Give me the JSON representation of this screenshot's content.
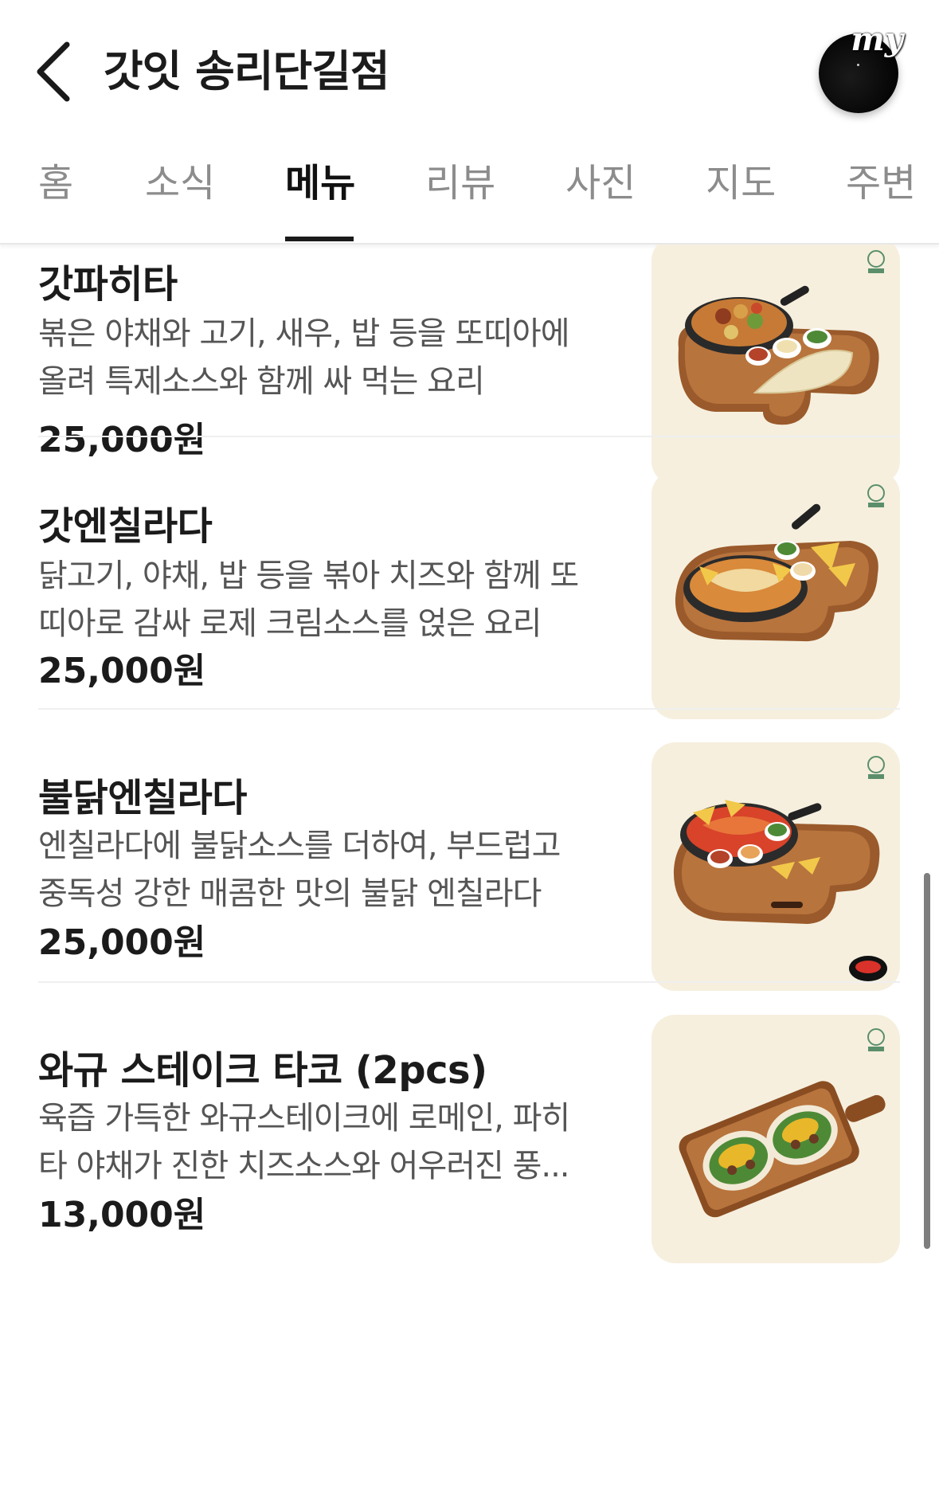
{
  "header": {
    "title": "갓잇 송리단길점",
    "my_label": "my",
    "back_icon": "chevron-left-icon"
  },
  "tabs": [
    {
      "label": "홈",
      "active": false
    },
    {
      "label": "소식",
      "active": false
    },
    {
      "label": "메뉴",
      "active": true
    },
    {
      "label": "리뷰",
      "active": false
    },
    {
      "label": "사진",
      "active": false
    },
    {
      "label": "지도",
      "active": false
    },
    {
      "label": "주변",
      "active": false
    }
  ],
  "menu": {
    "items": [
      {
        "name": "갓파히타",
        "desc_lines": [
          "볶은 야채와 고기, 새우, 밥 등을 또띠아에",
          "올려 특제소스와 함께 싸 먹는 요리"
        ],
        "price": "25,000원"
      },
      {
        "name": "갓엔칠라다",
        "desc_lines": [
          "닭고기, 야채, 밥 등을 볶아 치즈와 함께 또",
          "띠아로 감싸 로제 크림소스를 얹은 요리"
        ],
        "price": "25,000원"
      },
      {
        "name": "불닭엔칠라다",
        "desc_lines": [
          "엔칠라다에 불닭소스를 더하여, 부드럽고",
          "중독성 강한 매콤한 맛의 불닭 엔칠라다"
        ],
        "price": "25,000원"
      },
      {
        "name": "와규 스테이크 타코 (2pcs)",
        "desc_lines": [
          "육즙 가득한 와규스테이크에 로메인, 파히",
          "타 야채가 진한 치즈소스와 어우러진 풍..."
        ],
        "price": "13,000원"
      }
    ]
  },
  "colors": {
    "image_bg": "#f6efde",
    "active_tab": "#111111",
    "inactive_tab": "#8c8c8c",
    "wood": "#9a5a2b"
  }
}
